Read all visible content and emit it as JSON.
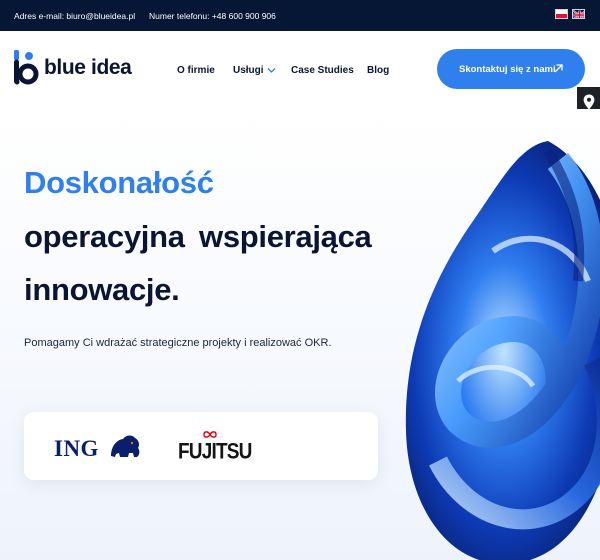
{
  "topbar": {
    "email_text": "Adres e-mail: biuro@blueidea.pl",
    "phone_text": "Numer telefonu: +48 600 900 906",
    "languages": [
      "pl",
      "en"
    ]
  },
  "header": {
    "logo_text": "blue idea",
    "nav": [
      "O firmie",
      "Usługi",
      "Case Studies",
      "Blog"
    ],
    "cta_label": "Skontaktuj się z nami"
  },
  "hero": {
    "title_line1": "Doskonałość",
    "title_line2": "operacyjna wspierająca",
    "title_line3": "innowacje.",
    "subtitle": "Pomagamy Ci wdrażać strategiczne projekty i realizować OKR."
  },
  "client_logos": [
    "ING",
    "FUJITSU"
  ],
  "colors": {
    "accent": "#2f80ed",
    "dark_navy": "#061735",
    "heading": "#0b1533"
  },
  "icons": {
    "cta": "arrow-up-right-icon",
    "side": "map-pin-icon",
    "nav_dropdown": "chevron-down-icon"
  }
}
